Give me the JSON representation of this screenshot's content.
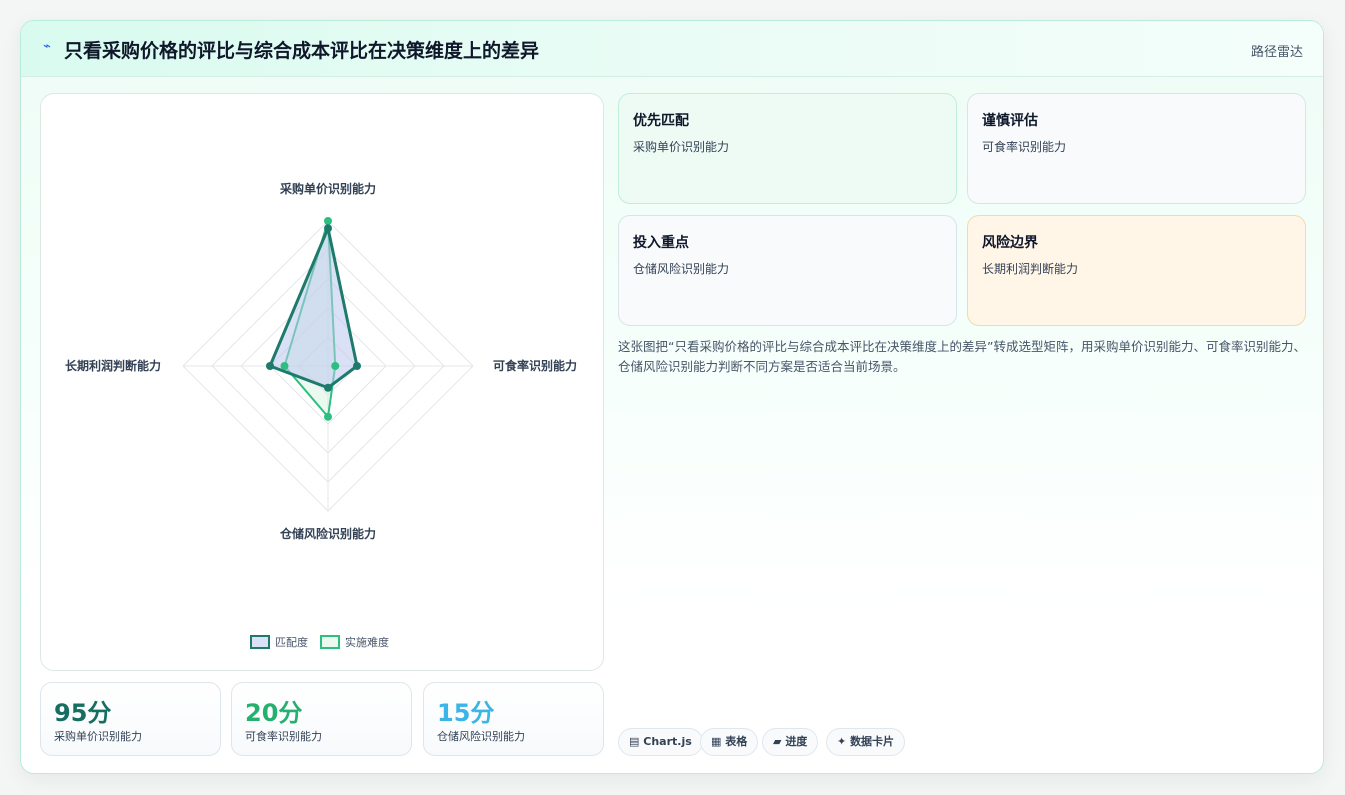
{
  "header": {
    "icon": "⌁",
    "title": "只看采购价格的评比与综合成本评比在决策维度上的差异",
    "tag": "路径雷达"
  },
  "chart_data": {
    "type": "radar",
    "axes": [
      "采购单价识别能力",
      "可食率识别能力",
      "仓储风险识别能力",
      "长期利润判断能力"
    ],
    "range": [
      0,
      100
    ],
    "grid_levels": 5,
    "series": [
      {
        "name": "匹配度",
        "values": [
          95,
          20,
          15,
          40
        ],
        "color": "#1e7a6b",
        "fill": "rgba(188, 200, 238, 0.55)"
      },
      {
        "name": "实施难度",
        "values": [
          100,
          5,
          35,
          30
        ],
        "color": "#2cbf7f",
        "fill": "rgba(200, 238, 215, 0.35)"
      }
    ]
  },
  "stats": [
    {
      "value": "95分",
      "label": "采购单价识别能力",
      "color": "#166e60"
    },
    {
      "value": "20分",
      "label": "可食率识别能力",
      "color": "#25b070"
    },
    {
      "value": "15分",
      "label": "仓储风险识别能力",
      "color": "#3bb4e6"
    }
  ],
  "tiles": [
    {
      "title": "优先匹配",
      "body": "采购单价识别能力",
      "bg": "#eefbf5",
      "border": "#bfeed9"
    },
    {
      "title": "谨慎评估",
      "body": "可食率识别能力",
      "bg": "#f8fafc",
      "border": "#d9e4ea"
    },
    {
      "title": "投入重点",
      "body": "仓储风险识别能力",
      "bg": "#f8fafc",
      "border": "#d9e4ea"
    },
    {
      "title": "风险边界",
      "body": "长期利润判断能力",
      "bg": "#fff6e8",
      "border": "#f5d9a8"
    }
  ],
  "description": "这张图把“只看采购价格的评比与综合成本评比在决策维度上的差异”转成选型矩阵，用采购单价识别能力、可食率识别能力、仓储风险识别能力判断不同方案是否适合当前场景。",
  "chips": [
    {
      "icon": "▤",
      "label": "Chart.js"
    },
    {
      "icon": "▦",
      "label": "表格"
    },
    {
      "icon": "▰",
      "label": "进度"
    },
    {
      "icon": "✦",
      "label": "数据卡片"
    }
  ]
}
